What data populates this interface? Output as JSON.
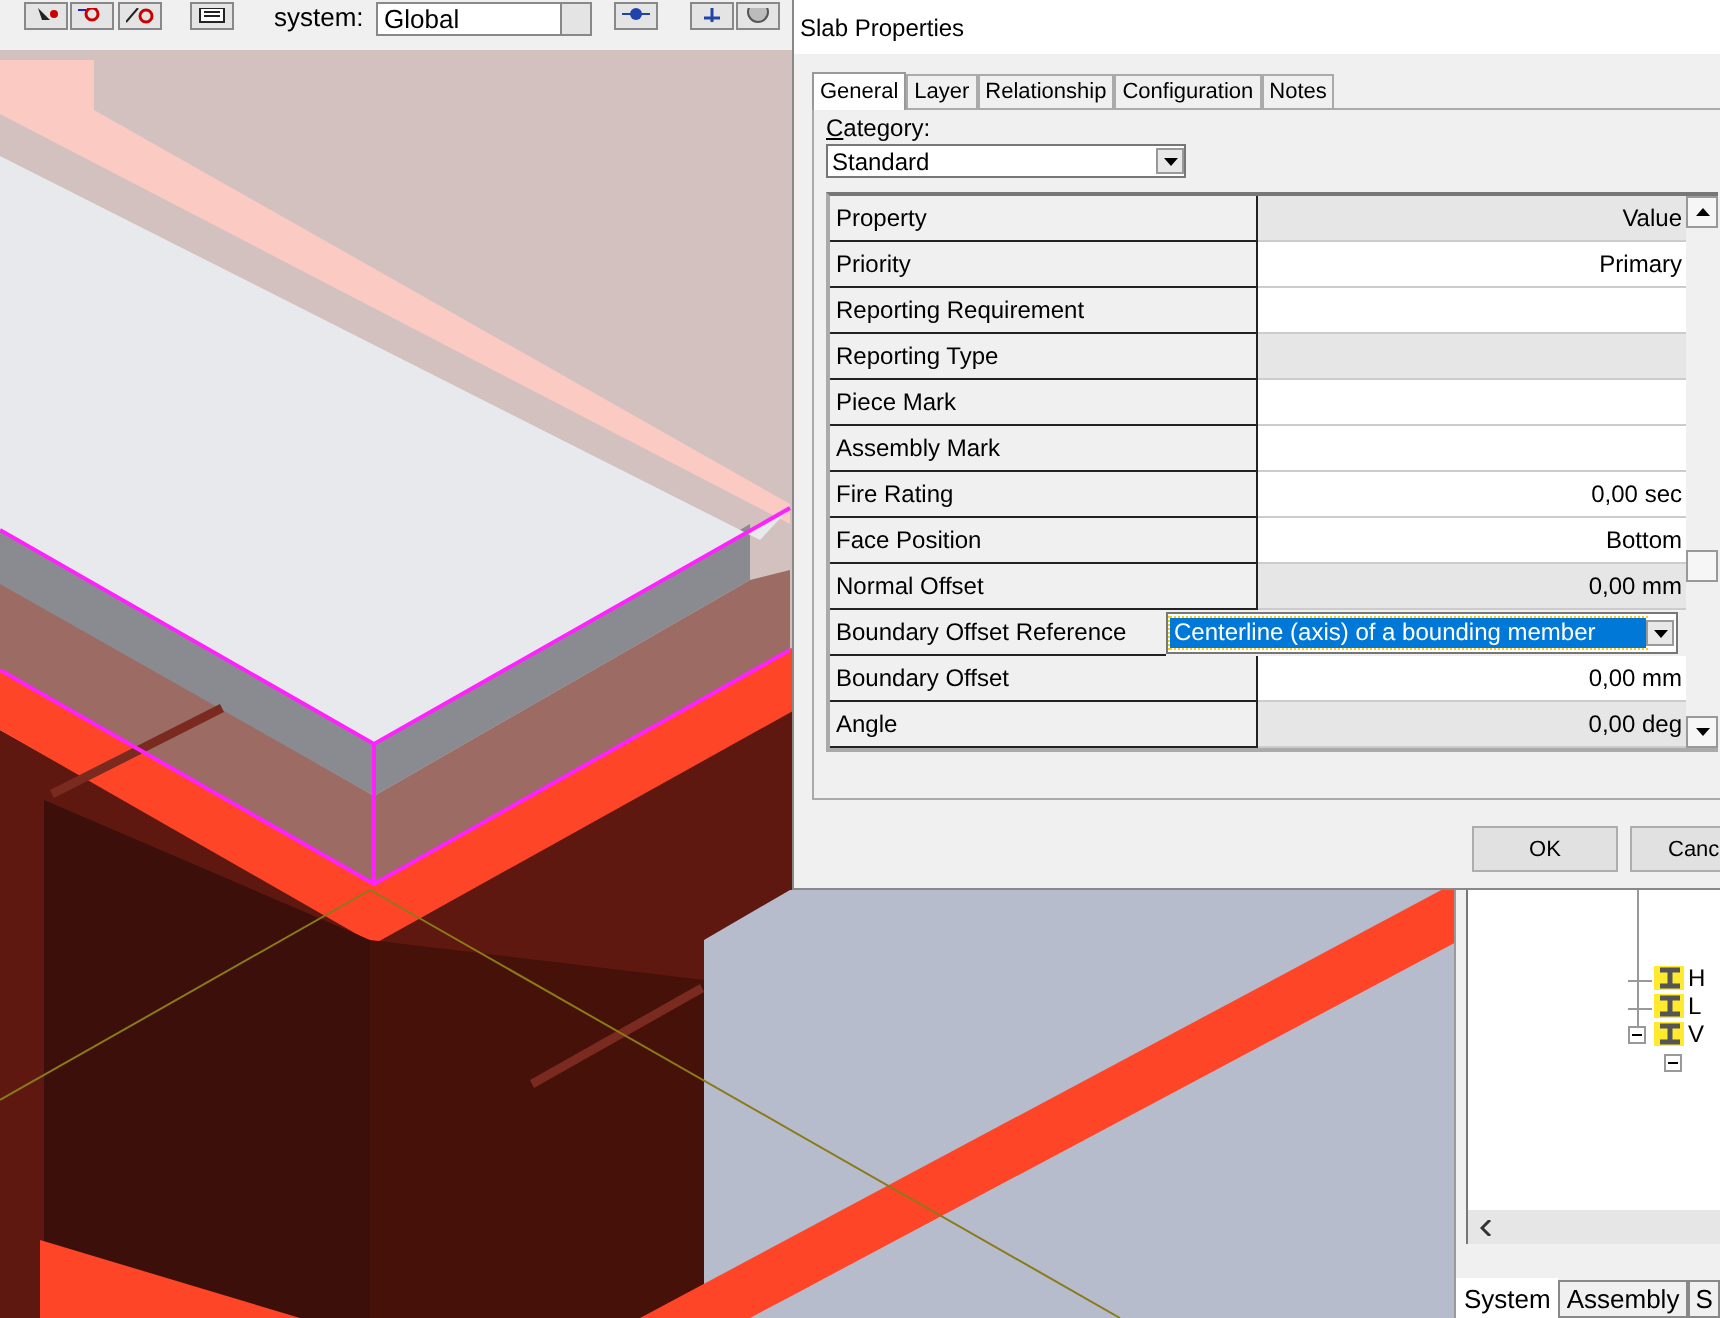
{
  "toolbar": {
    "system_label": "system:",
    "system_combo": "Global"
  },
  "dialog": {
    "title": "Slab Properties",
    "tabs": [
      {
        "label": "General",
        "selected": true
      },
      {
        "label": "Layer",
        "selected": false
      },
      {
        "label": "Relationship",
        "selected": false
      },
      {
        "label": "Configuration",
        "selected": false
      },
      {
        "label": "Notes",
        "selected": false
      }
    ],
    "category_label": "Category:",
    "category_value": "Standard",
    "grid": {
      "columns": [
        "Property",
        "Value"
      ],
      "rows": [
        {
          "name": "Priority",
          "value": "Primary",
          "kind": "text",
          "editable": true
        },
        {
          "name": "Reporting Requirement",
          "value": "",
          "kind": "text",
          "editable": true
        },
        {
          "name": "Reporting Type",
          "value": "",
          "kind": "text",
          "editable": false
        },
        {
          "name": "Piece Mark",
          "value": "",
          "kind": "text",
          "editable": true
        },
        {
          "name": "Assembly Mark",
          "value": "",
          "kind": "text",
          "editable": true
        },
        {
          "name": "Fire Rating",
          "value": "0,00 sec",
          "kind": "text",
          "editable": true
        },
        {
          "name": "Face Position",
          "value": "Bottom",
          "kind": "text",
          "editable": true
        },
        {
          "name": "Normal Offset",
          "value": "0,00 mm",
          "kind": "text",
          "editable": false
        },
        {
          "name": "Boundary Offset Reference",
          "value": "Centerline (axis) of a bounding member",
          "kind": "dropdown",
          "editable": true
        },
        {
          "name": "Boundary Offset",
          "value": "0,00 mm",
          "kind": "text",
          "editable": true
        },
        {
          "name": "Angle",
          "value": "0,00 deg",
          "kind": "text",
          "editable": false
        }
      ]
    },
    "buttons": [
      "OK",
      "Canc"
    ]
  },
  "tree_panel": {
    "items": [
      {
        "label": "H"
      },
      {
        "label": "L"
      },
      {
        "label": "V",
        "expanded": true,
        "children": [
          {
            "expanded": true
          }
        ]
      }
    ],
    "tabs": [
      {
        "label": "System",
        "selected": true
      },
      {
        "label": "Assembly",
        "selected": false
      },
      {
        "label": "S",
        "selected": false
      }
    ]
  }
}
